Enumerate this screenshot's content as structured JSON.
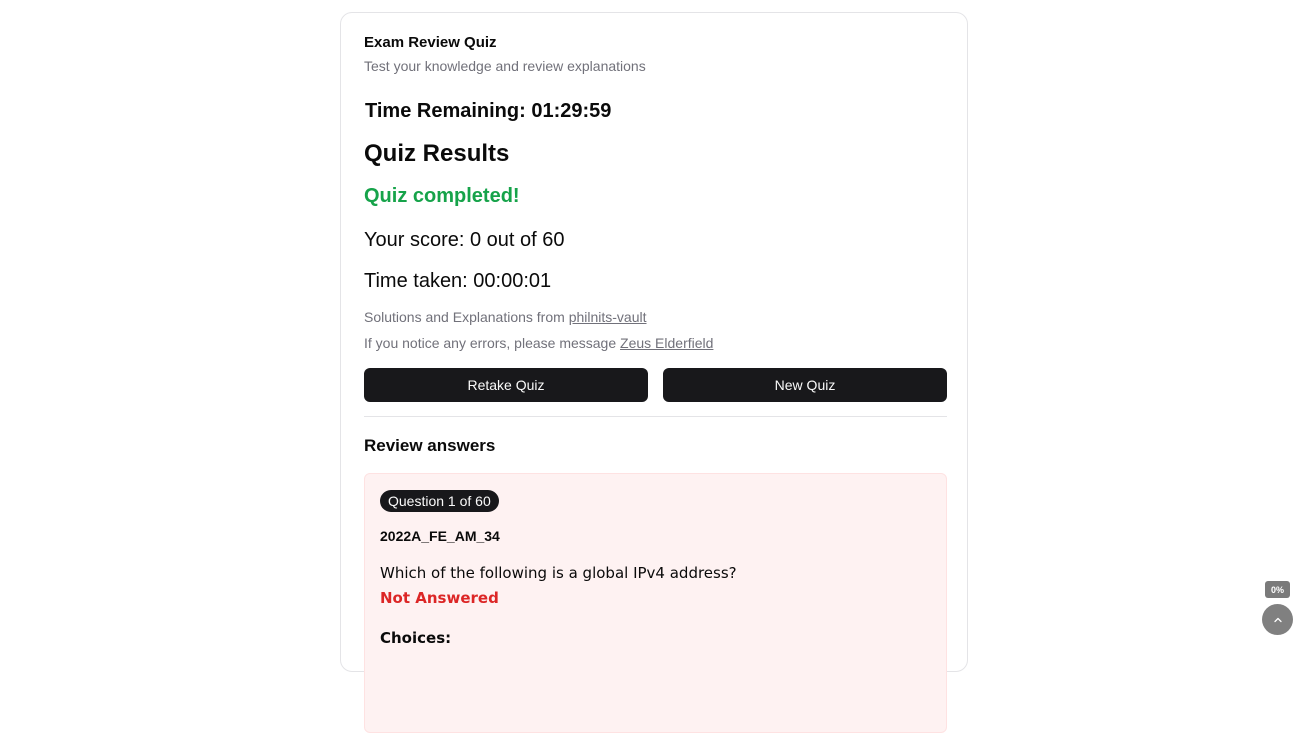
{
  "quiz": {
    "title": "Exam Review Quiz",
    "subtitle": "Test your knowledge and review explanations",
    "timer": "Time Remaining: 01:29:59"
  },
  "results": {
    "heading": "Quiz Results",
    "status": "Quiz completed!",
    "score": "Your score: 0 out of 60",
    "time_taken": "Time taken: 00:00:01",
    "credit_prefix": "Solutions and Explanations from ",
    "credit_link": "philnits-vault",
    "errors_prefix": "If you notice any errors, please message ",
    "errors_link": "Zeus Elderfield",
    "retake_label": "Retake Quiz",
    "new_label": "New Quiz"
  },
  "review": {
    "heading": "Review answers",
    "question": {
      "badge": "Question 1 of 60",
      "id": "2022A_FE_AM_34",
      "text": "Which of the following is a global IPv4 address?",
      "status": "Not Answered",
      "choices_label": "Choices:"
    }
  },
  "page_widget": {
    "progress_value": 0,
    "progress_label": "0%",
    "scroll_top_icon": "chevron-up-icon"
  },
  "colors": {
    "success": "#16a34a",
    "error": "#dc2626",
    "primary_button": "#18181b",
    "question_card_bg": "#fef2f2"
  }
}
